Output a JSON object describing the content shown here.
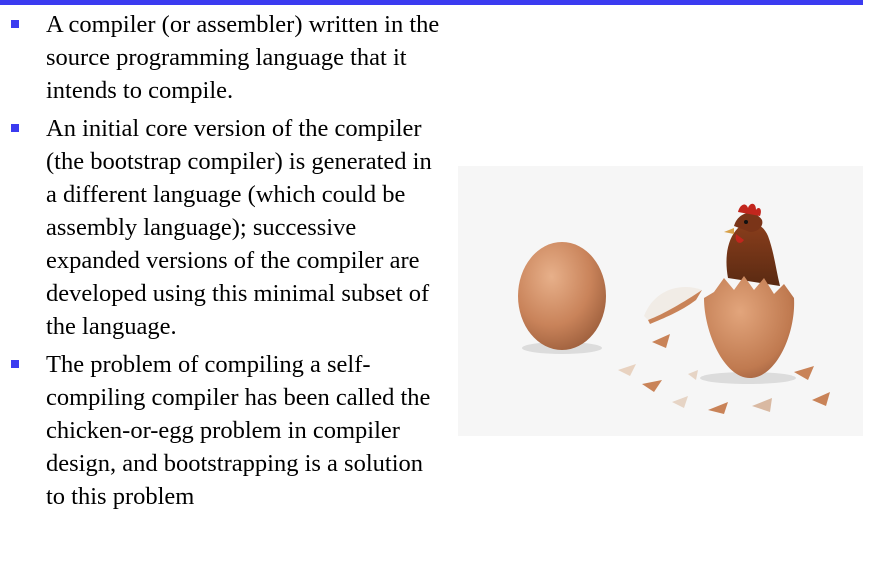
{
  "slide": {
    "bullets": [
      {
        "text": "A compiler (or assembler) written in the source programming language that it intends to compile."
      },
      {
        "text": "An initial core version of the compiler (the bootstrap compiler) is generated in a different language (which could be assembly language); successive expanded versions of the compiler are developed using this minimal subset of the language."
      },
      {
        "text": "The problem of compiling a self-compiling compiler has been called the chicken-or-egg problem in compiler design, and bootstrapping is a solution to this problem"
      }
    ]
  },
  "colors": {
    "accent": "#3b3bf0",
    "text": "#000000",
    "background": "#ffffff"
  },
  "image": {
    "icon": "chicken-hatching-from-egg-photo"
  }
}
